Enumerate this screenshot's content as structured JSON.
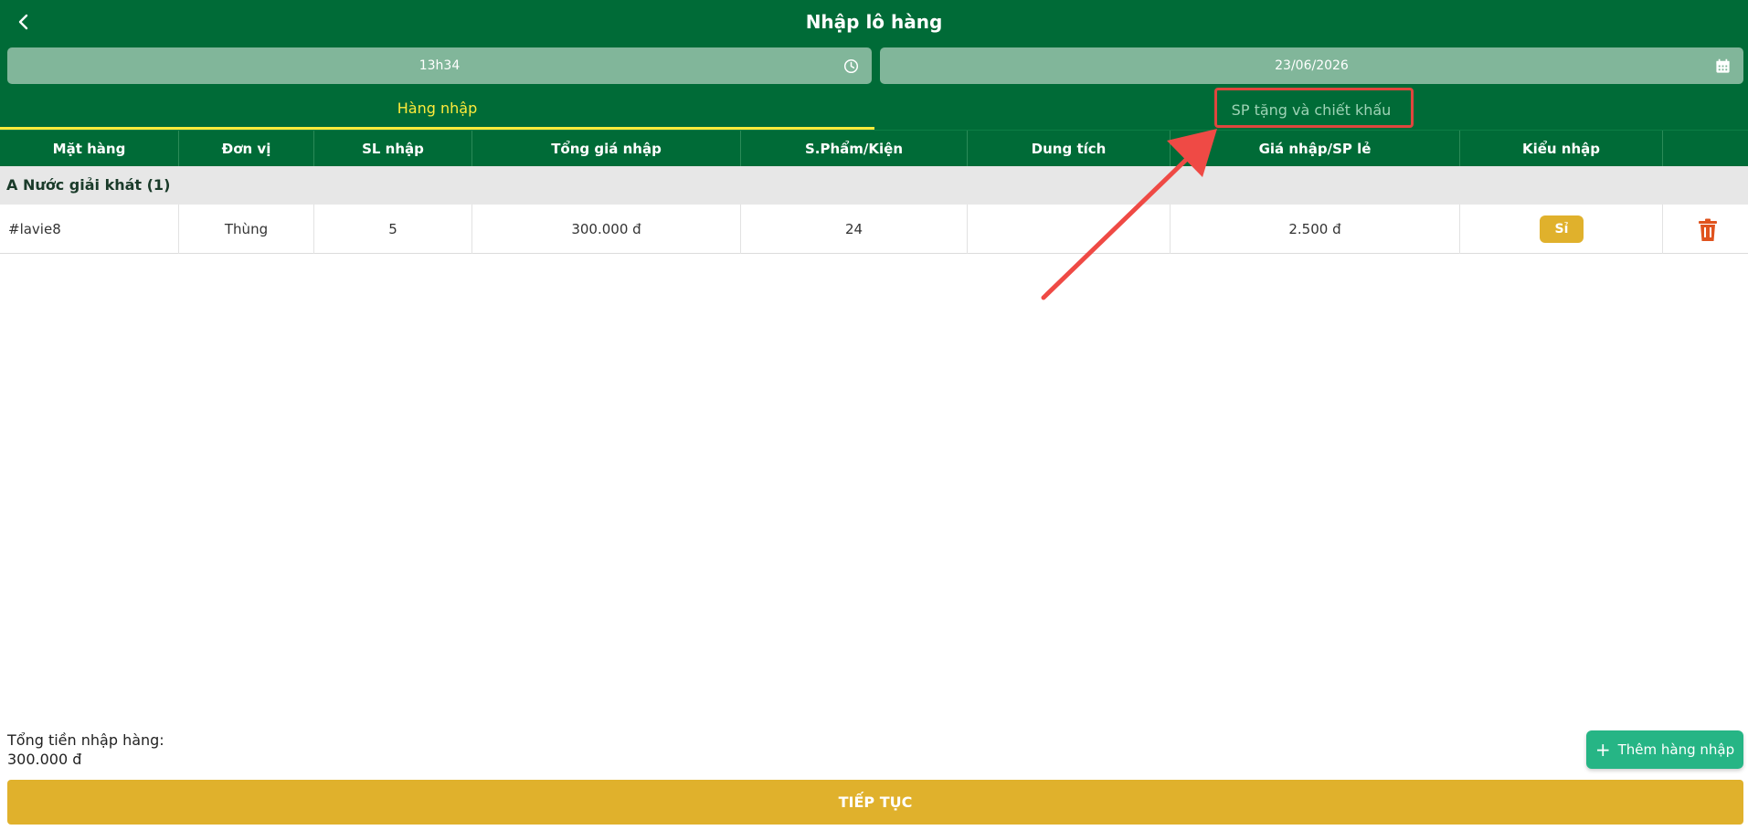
{
  "header": {
    "title": "Nhập lô hàng"
  },
  "fields": {
    "time": "13h34",
    "date": "23/06/2026"
  },
  "tabs": [
    {
      "label": "Hàng nhập",
      "active": true
    },
    {
      "label": "SP tặng và chiết khấu",
      "active": false
    }
  ],
  "table": {
    "columns": [
      "Mặt hàng",
      "Đơn vị",
      "SL nhập",
      "Tổng giá nhập",
      "S.Phẩm/Kiện",
      "Dung tích",
      "Giá nhập/SP lẻ",
      "Kiểu nhập",
      ""
    ],
    "groups": [
      {
        "name": "A Nước giải khát (1)",
        "rows": [
          {
            "item": "#lavie8",
            "unit": "Thùng",
            "qty": "5",
            "total": "300.000 đ",
            "per_pack": "24",
            "volume": "",
            "unit_price": "2.500 đ",
            "type": "Sỉ"
          }
        ]
      }
    ]
  },
  "footer": {
    "total_label": "Tổng tiền nhập hàng:",
    "total_value": "300.000 đ",
    "add_button": "Thêm hàng nhập",
    "continue_button": "TIẾP TỤC"
  },
  "colors": {
    "primary": "#006b37",
    "field": "#81b69a",
    "accent_yellow": "#e0b12c",
    "active_tab": "#ffeb3b",
    "add_button": "#26b585",
    "annotation": "#e0463e",
    "delete": "#e0531e"
  },
  "icons": {
    "back": "chevron-left-icon",
    "time": "clock-icon",
    "date": "calendar-icon",
    "delete": "trash-icon",
    "add": "plus-icon"
  }
}
